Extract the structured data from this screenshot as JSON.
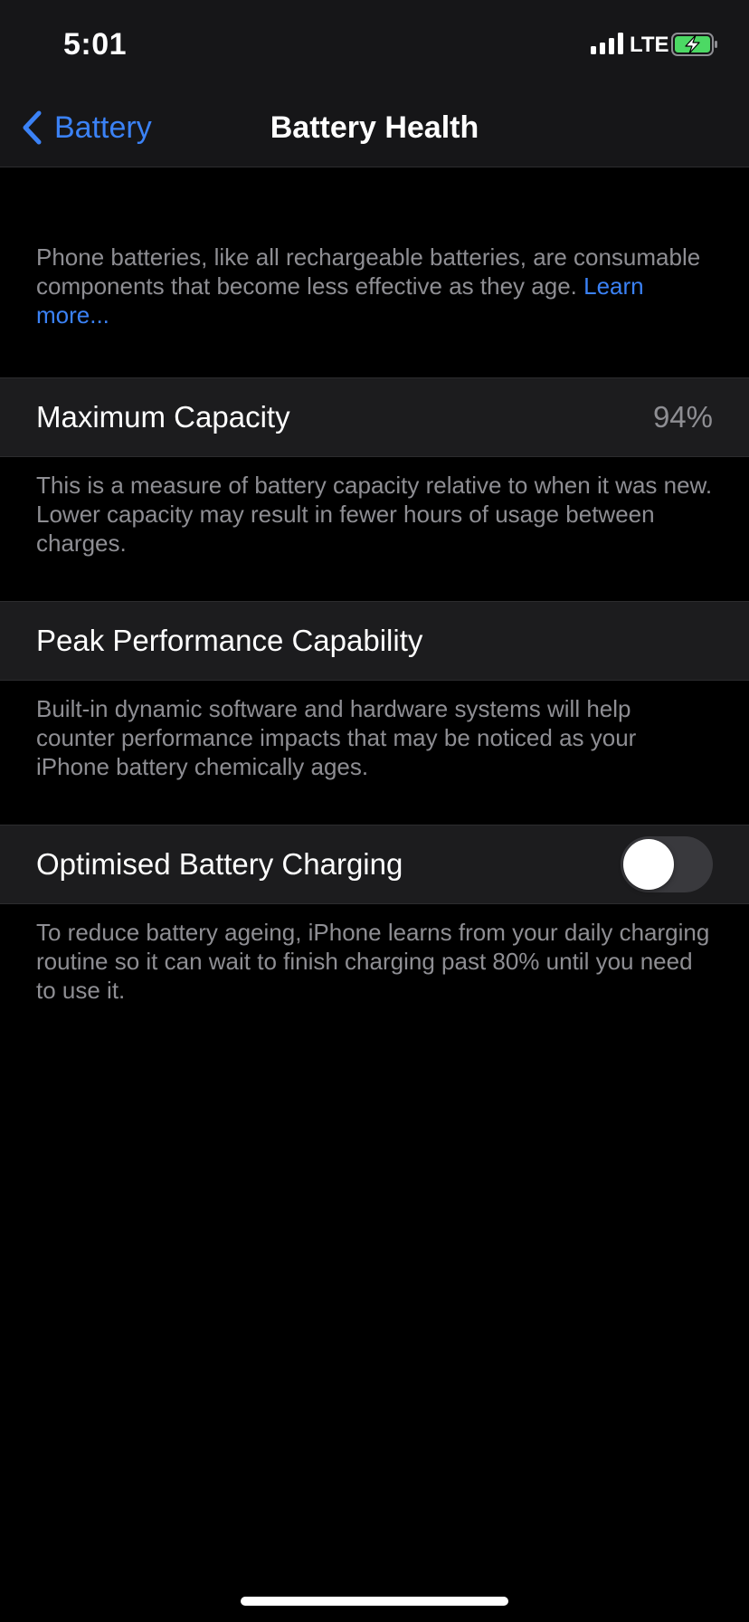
{
  "status_bar": {
    "time": "5:01",
    "network": "LTE",
    "icons": [
      "signal-icon",
      "battery-charging-icon"
    ],
    "battery_color": "#4cd964"
  },
  "nav": {
    "back_label": "Battery",
    "title": "Battery Health",
    "accent_color": "#3b82f6"
  },
  "intro": {
    "text": "Phone batteries, like all rechargeable batteries, are consumable components that become less effective as they age.",
    "link": "Learn more..."
  },
  "max_capacity": {
    "label": "Maximum Capacity",
    "value": "94%",
    "note": "This is a measure of battery capacity relative to when it was new. Lower capacity may result in fewer hours of usage between charges."
  },
  "peak_performance": {
    "label": "Peak Performance Capability",
    "note": "Built-in dynamic software and hardware systems will help counter performance impacts that may be noticed as your iPhone battery chemically ages."
  },
  "optimised_charging": {
    "label": "Optimised Battery Charging",
    "enabled": false,
    "note": "To reduce battery ageing, iPhone learns from your daily charging routine so it can wait to finish charging past 80% until you need to use it."
  }
}
